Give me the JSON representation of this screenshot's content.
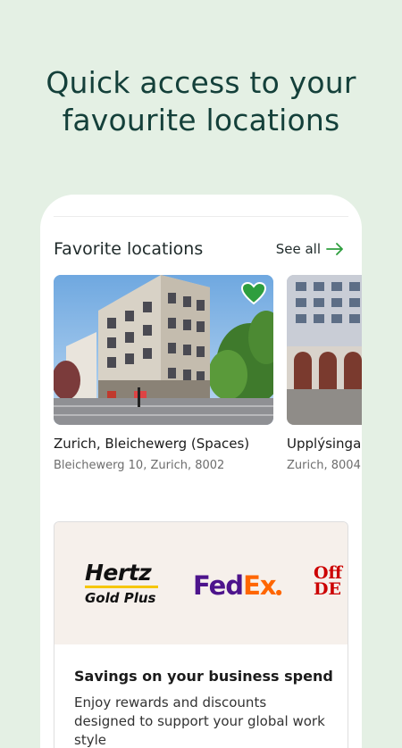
{
  "headline": {
    "line1": "Quick access to your",
    "line2": "favourite locations"
  },
  "favorites": {
    "title": "Favorite locations",
    "see_all": "See all",
    "arrow_icon": "arrow-right-icon",
    "accent_color": "#2e9e3e",
    "items": [
      {
        "name": "Zurich, Bleichewerg (Spaces)",
        "address": "Bleichewerg 10, Zurich, 8002",
        "favorited": true,
        "heart_icon": "heart-icon"
      },
      {
        "name": "Upplýsinga",
        "address": "Zurich, 8004"
      }
    ]
  },
  "partners": {
    "logos": {
      "hertz": "Hertz",
      "hertz_sub": "Gold Plus",
      "fedex_fed": "Fed",
      "fedex_ex": "Ex",
      "office_line1": "Off",
      "office_line2": "DE"
    },
    "title": "Savings on your business spend",
    "description": "Enjoy rewards and discounts designed to support your global work style"
  }
}
